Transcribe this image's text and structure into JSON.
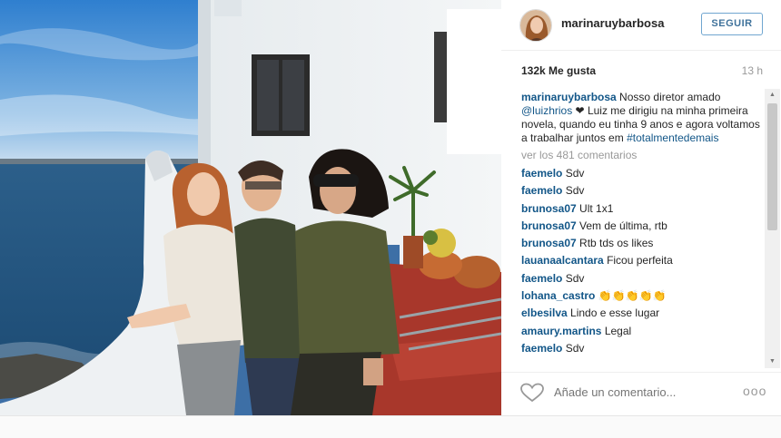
{
  "post": {
    "username": "marinaruybarbosa",
    "follow_label": "SEGUIR",
    "likes": "132k Me gusta",
    "time": "13 h",
    "caption": {
      "user": "marinaruybarbosa",
      "text_1": " Nosso diretor amado ",
      "mention": "@luizhrios",
      "heart": " ❤ ",
      "text_2": "Luiz me dirigiu na minha primeira novela, quando eu tinha 9 anos e agora voltamos a trabalhar juntos em ",
      "hashtag": "#totalmentedemais"
    },
    "view_all": "ver los 481 comentarios",
    "comments": [
      {
        "user": "faemelo",
        "text": "Sdv"
      },
      {
        "user": "faemelo",
        "text": "Sdv"
      },
      {
        "user": "brunosa07",
        "text": "Ult 1x1"
      },
      {
        "user": "brunosa07",
        "text": "Vem de última, rtb"
      },
      {
        "user": "brunosa07",
        "text": "Rtb tds os likes"
      },
      {
        "user": "lauanaalcantara",
        "text": "Ficou perfeita"
      },
      {
        "user": "faemelo",
        "text": "Sdv"
      },
      {
        "user": "lohana_castro",
        "text": "👏👏👏👏👏"
      },
      {
        "user": "elbesilva",
        "text": "Lindo e esse lugar"
      },
      {
        "user": "amaury.martins",
        "text": "Legal"
      },
      {
        "user": "faemelo",
        "text": "Sdv"
      }
    ],
    "add_comment_placeholder": "Añade un comentario...",
    "more_label": "ooo"
  },
  "colors": {
    "link": "#125688",
    "follow_border": "#70a6d0",
    "muted": "#999999"
  },
  "icons": {
    "like": "heart-outline-icon",
    "more": "ellipsis-icon"
  }
}
